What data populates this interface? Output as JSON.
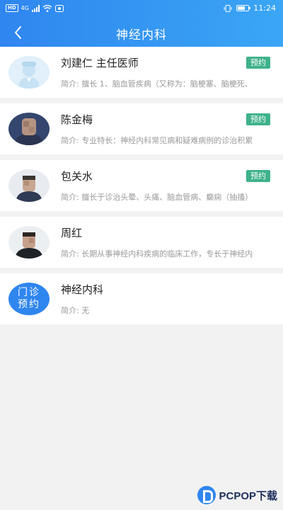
{
  "status": {
    "hd": "HD",
    "net": "4G",
    "time": "11:24"
  },
  "header": {
    "title": "神经内科"
  },
  "doctors": [
    {
      "name": "刘建仁  主任医师",
      "intro": "简介: 擅长 1、脑血管疾病（又称为：脑梗塞、脑梗死、",
      "badge": "预约"
    },
    {
      "name": "陈金梅",
      "intro": "简介: 专业特长：神经内科常见病和疑难病例的诊治积累",
      "badge": "预约"
    },
    {
      "name": "包关水",
      "intro": "简介: 擅长于诊治头晕、头痛、脑血管病、癫痫（抽搐）",
      "badge": "预约"
    },
    {
      "name": "周红",
      "intro": "简介: 长期从事神经内科疾病的临床工作，专长于神经内",
      "badge": ""
    }
  ],
  "clinic": {
    "avatar_line1": "门诊",
    "avatar_line2": "预约",
    "name": "神经内科",
    "intro": "简介: 无"
  },
  "watermark": {
    "text": "PCPOP下载"
  },
  "colors": {
    "primary": "#2f86ef",
    "badge": "#3fb28b"
  }
}
